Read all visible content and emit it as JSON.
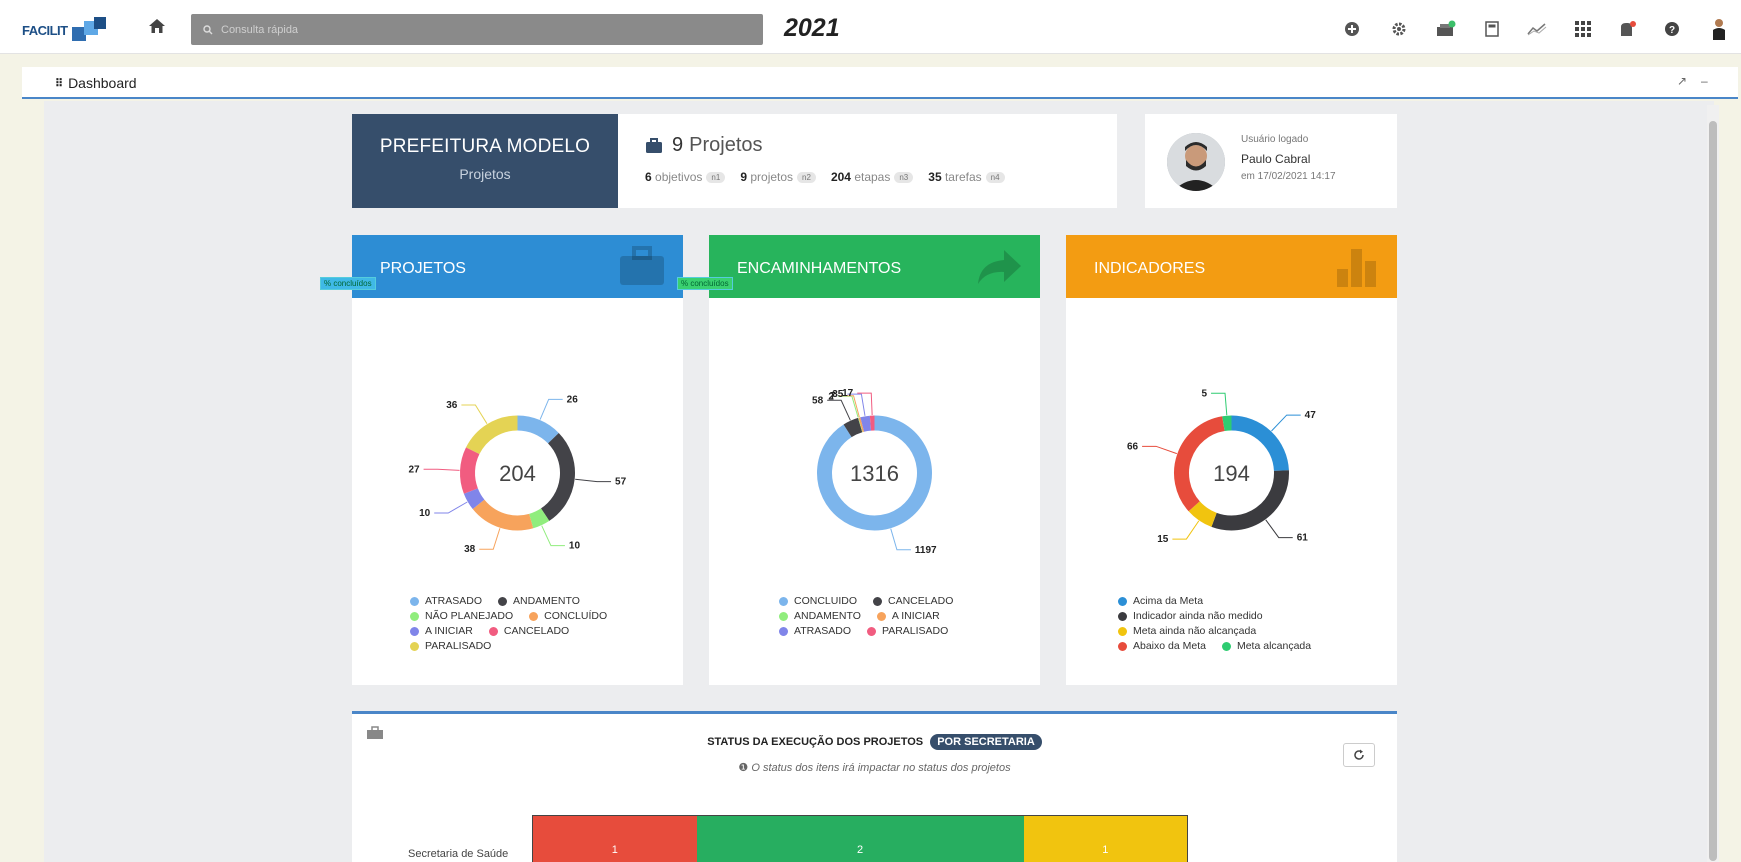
{
  "topbar": {
    "logo_text": "FACILIT",
    "search_placeholder": "Consulta rápida",
    "year": "2021",
    "icons": [
      "plus-circle-icon",
      "gear-icon",
      "inbox-icon",
      "calculator-icon",
      "trend-icon",
      "grid-icon",
      "notification-icon",
      "help-icon",
      "user-icon"
    ]
  },
  "dashboard": {
    "title": "Dashboard"
  },
  "org": {
    "name": "PREFEITURA MODELO",
    "subtitle": "Projetos",
    "project_count": "9",
    "project_label": "Projetos",
    "stats": [
      {
        "value": "6",
        "label": "objetivos",
        "pill": "n1"
      },
      {
        "value": "9",
        "label": "projetos",
        "pill": "n2"
      },
      {
        "value": "204",
        "label": "etapas",
        "pill": "n3"
      },
      {
        "value": "35",
        "label": "tarefas",
        "pill": "n4"
      }
    ]
  },
  "user": {
    "label": "Usuário logado",
    "name": "Paulo Cabral",
    "since": "em 17/02/2021 14:17"
  },
  "cards": [
    {
      "title": "PROJETOS",
      "tag": "% concluídos",
      "color": "#2d8dd4",
      "total": "204",
      "segments": [
        {
          "label": "ATRASADO",
          "value": 26,
          "color": "#7cb5ec"
        },
        {
          "label": "ANDAMENTO",
          "value": 57,
          "color": "#434348"
        },
        {
          "label": "NÃO PLANEJADO",
          "value": 10,
          "color": "#90ed7d"
        },
        {
          "label": "CONCLUÍDO",
          "value": 38,
          "color": "#f7a35c"
        },
        {
          "label": "A INICIAR",
          "value": 10,
          "color": "#8085e9"
        },
        {
          "label": "CANCELADO",
          "value": 27,
          "color": "#f15c80"
        },
        {
          "label": "PARALISADO",
          "value": 36,
          "color": "#e4d354"
        }
      ]
    },
    {
      "title": "ENCAMINHAMENTOS",
      "tag": "% concluídos",
      "color": "#27b45c",
      "total": "1316",
      "segments": [
        {
          "label": "CONCLUIDO",
          "value": 1197,
          "color": "#7cb5ec"
        },
        {
          "label": "CANCELADO",
          "value": 58,
          "color": "#434348"
        },
        {
          "label": "ANDAMENTO",
          "value": 2,
          "color": "#90ed7d"
        },
        {
          "label": "A INICIAR",
          "value": 7,
          "color": "#f7a35c"
        },
        {
          "label": "ATRASADO",
          "value": 35,
          "color": "#8085e9"
        },
        {
          "label": "PARALISADO",
          "value": 17,
          "color": "#f15c80"
        }
      ]
    },
    {
      "title": "INDICADORES",
      "tag": "",
      "color": "#f39c12",
      "total": "194",
      "segments": [
        {
          "label": "Acima da Meta",
          "value": 47,
          "color": "#2b8fd6"
        },
        {
          "label": "Indicador ainda não medido",
          "value": 61,
          "color": "#3b3b3f"
        },
        {
          "label": "Meta ainda não alcançada",
          "value": 15,
          "color": "#f1c40f"
        },
        {
          "label": "Abaixo da Meta",
          "value": 66,
          "color": "#e74c3c"
        },
        {
          "label": "Meta alcançada",
          "value": 5,
          "color": "#2ecc71"
        }
      ]
    }
  ],
  "status": {
    "title": "STATUS DA EXECUÇÃO DOS PROJETOS",
    "badge": "POR SECRETARIA",
    "subtitle": "O status dos itens irá impactar no status dos projetos",
    "row_label": "Secretaria de Saúde",
    "bars": [
      {
        "value": "1",
        "color": "#e74c3c"
      },
      {
        "value": "2",
        "color": "#27ae60"
      },
      {
        "value": "1",
        "color": "#f1c40f"
      }
    ]
  }
}
